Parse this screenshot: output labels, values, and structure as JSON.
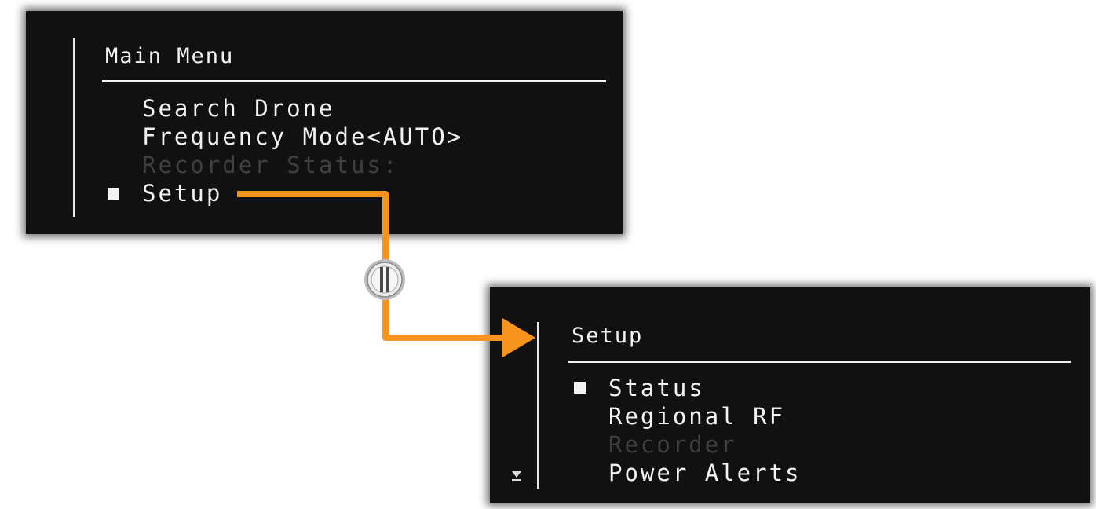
{
  "main_menu": {
    "title": "Main Menu",
    "items": [
      {
        "label": "Search Drone",
        "disabled": false
      },
      {
        "label": "Frequency Mode<AUTO>",
        "disabled": false
      },
      {
        "label": "Recorder Status:",
        "disabled": true
      },
      {
        "label": "Setup",
        "disabled": false,
        "selected": true
      }
    ]
  },
  "setup_menu": {
    "title": "Setup",
    "items": [
      {
        "label": "Status",
        "disabled": false,
        "selected": true
      },
      {
        "label": "Regional RF",
        "disabled": false
      },
      {
        "label": "Recorder",
        "disabled": true
      },
      {
        "label": "Power Alerts",
        "disabled": false
      }
    ]
  },
  "colors": {
    "screen_bg": "#111111",
    "text": "#f2f2f2",
    "disabled_text": "#3f3f3f",
    "connector": "#f7941d",
    "button_fill": "#e6e6e6"
  },
  "icons": {
    "cursor": "filled-square-icon",
    "scroll_more": "down-arrow-icon",
    "connector_button": "dial-button-icon"
  }
}
